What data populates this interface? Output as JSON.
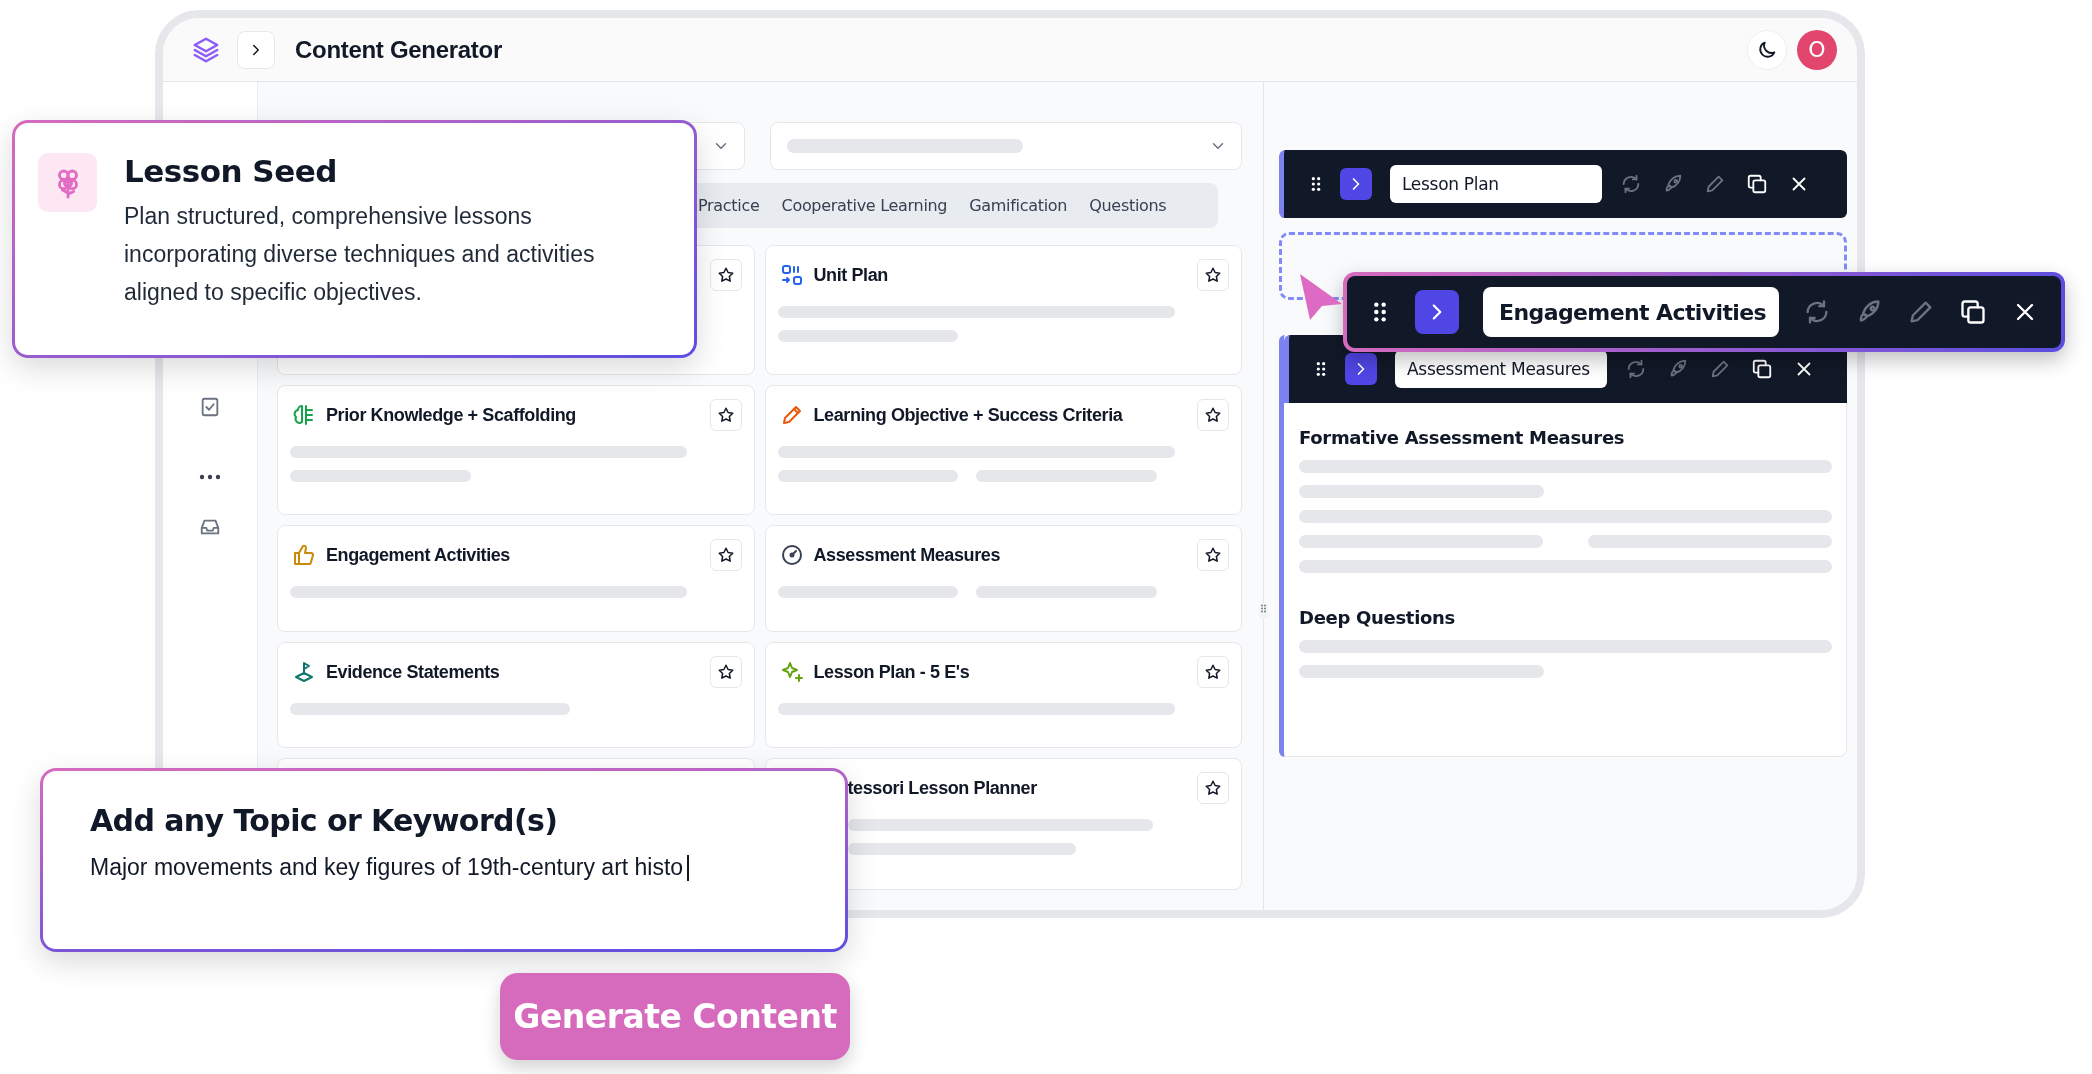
{
  "app": {
    "title": "Content Generator",
    "avatar": "O"
  },
  "lesson_seed": {
    "title": "Lesson Seed",
    "description": "Plan structured, comprehensive lessons incorporating diverse techniques and activities aligned to specific objectives."
  },
  "tabs": [
    {
      "label": "Practice",
      "selected": false
    },
    {
      "label": "Cooperative Learning",
      "selected": false
    },
    {
      "label": "Gamification",
      "selected": false
    },
    {
      "label": "Questions",
      "selected": false
    }
  ],
  "cards": [
    {
      "kind": "covered",
      "starred": false
    },
    {
      "kind": "tool",
      "title": "Unit Plan",
      "starred": false
    },
    {
      "kind": "tool",
      "title": "Prior Knowledge + Scaffolding",
      "starred": false
    },
    {
      "kind": "tool",
      "title": "Learning Objective + Success Criteria",
      "starred": false
    },
    {
      "kind": "tool",
      "title": "Engagement Activities",
      "starred": false
    },
    {
      "kind": "tool",
      "title": "Assessment Measures",
      "starred": false
    },
    {
      "kind": "tool",
      "title": "Evidence Statements",
      "starred": false
    },
    {
      "kind": "tool",
      "title": "Lesson Plan - 5 E's",
      "starred": false
    },
    {
      "kind": "covered"
    },
    {
      "kind": "partial",
      "title": "tessori Lesson Planner",
      "starred": false
    }
  ],
  "workspace": {
    "blocks": [
      {
        "title": "Lesson Plan"
      },
      {
        "title": "Assessment Measures",
        "sections": [
          {
            "heading": "Formative Assessment Measures"
          },
          {
            "heading": "Deep Questions"
          }
        ]
      }
    ],
    "dragging": {
      "title": "Engagement Activities"
    }
  },
  "topic": {
    "label": "Add any Topic or Keyword(s)",
    "value": "Major movements and key figures of 19th-century art histo"
  },
  "generate_button": {
    "label": "Generate Content"
  }
}
